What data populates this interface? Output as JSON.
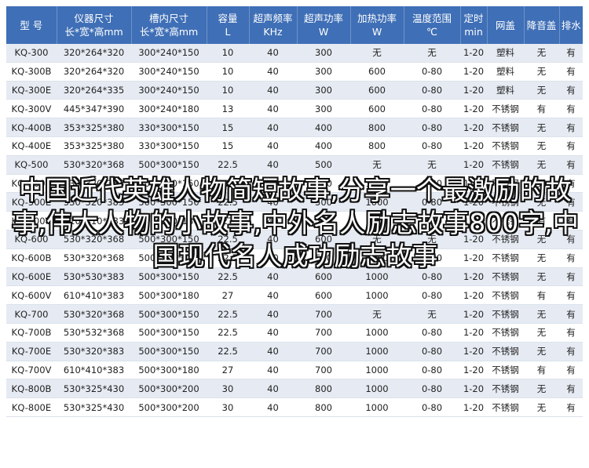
{
  "table": {
    "headers": [
      {
        "l1": "型 号",
        "l2": ""
      },
      {
        "l1": "仪器尺寸",
        "l2": "长*宽*高mm"
      },
      {
        "l1": "槽内尺寸",
        "l2": "长*宽*高mm"
      },
      {
        "l1": "容量",
        "l2": "L"
      },
      {
        "l1": "超声频率",
        "l2": "KHz"
      },
      {
        "l1": "超声功率",
        "l2": "W"
      },
      {
        "l1": "加热功率",
        "l2": "W"
      },
      {
        "l1": "温度范围",
        "l2": "℃"
      },
      {
        "l1": "定时",
        "l2": "min"
      },
      {
        "l1": "网盖",
        "l2": ""
      },
      {
        "l1": "降音盖",
        "l2": ""
      },
      {
        "l1": "排水",
        "l2": ""
      }
    ],
    "rows": [
      [
        "KQ-300",
        "320*264*320",
        "300*240*150",
        "10",
        "40",
        "300",
        "无",
        "无",
        "1-20",
        "塑料",
        "无",
        "有"
      ],
      [
        "KQ-300B",
        "320*264*320",
        "300*240*150",
        "10",
        "40",
        "300",
        "600",
        "0-80",
        "1-20",
        "塑料",
        "无",
        "有"
      ],
      [
        "KQ-300E",
        "320*264*335",
        "300*240*150",
        "10",
        "40",
        "300",
        "600",
        "0-80",
        "1-20",
        "塑料",
        "无",
        "有"
      ],
      [
        "KQ-300V",
        "445*347*390",
        "300*240*180",
        "13",
        "40",
        "300",
        "600",
        "0-80",
        "1-20",
        "不锈钢",
        "有",
        "有"
      ],
      [
        "KQ-400B",
        "353*325*380",
        "330*300*150",
        "15",
        "40",
        "400",
        "800",
        "0-80",
        "1-20",
        "不锈钢",
        "无",
        "有"
      ],
      [
        "KQ-400E",
        "353*325*380",
        "330*300*150",
        "15",
        "40",
        "400",
        "800",
        "0-80",
        "1-20",
        "不锈钢",
        "无",
        "有"
      ],
      [
        "KQ-500",
        "530*320*368",
        "500*300*150",
        "22.5",
        "40",
        "500",
        "无",
        "无",
        "1-20",
        "不锈钢",
        "无",
        "有"
      ],
      [
        "KQ-500B",
        "530*320*368",
        "500*300*150",
        "22.5",
        "40",
        "500",
        "1000",
        "0-80",
        "1-20",
        "不锈钢",
        "无",
        "有"
      ],
      [
        "KQ-500E",
        "530*320*383",
        "500*300*150",
        "22.5",
        "40",
        "500",
        "1000",
        "0-80",
        "1-20",
        "不锈钢",
        "无",
        "有"
      ],
      [
        "KQ-500V",
        "610*410*383",
        "500*300*180",
        "27",
        "40",
        "500",
        "1000",
        "0-80",
        "1-20",
        "不锈钢",
        "有",
        "有"
      ],
      [
        "KQ-600",
        "530*320*368",
        "500*300*150",
        "22.5",
        "40",
        "600",
        "无",
        "无",
        "1-20",
        "不锈钢",
        "无",
        "有"
      ],
      [
        "KQ-600B",
        "530*320*368",
        "500*300*150",
        "22.5",
        "40",
        "600",
        "1000",
        "0-80",
        "1-20",
        "不锈钢",
        "无",
        "有"
      ],
      [
        "KQ-600E",
        "530*530*383",
        "500*300*150",
        "22.5",
        "40",
        "600",
        "1000",
        "0-80",
        "1-20",
        "不锈钢",
        "无",
        "有"
      ],
      [
        "KQ-600V",
        "610*410*383",
        "500*300*180",
        "27",
        "40",
        "600",
        "1000",
        "0-80",
        "1-20",
        "不锈钢",
        "有",
        "有"
      ],
      [
        "KQ-700",
        "530*320*368",
        "500*300*150",
        "22.5",
        "40",
        "700",
        "无",
        "无",
        "1-20",
        "不锈钢",
        "无",
        "有"
      ],
      [
        "KQ-700B",
        "530*532*368",
        "500*300*150",
        "22.5",
        "40",
        "700",
        "1000",
        "0-80",
        "1-20",
        "不锈钢",
        "无",
        "有"
      ],
      [
        "KQ-700E",
        "530*320*383",
        "500*300*150",
        "22.5",
        "40",
        "700",
        "1000",
        "0-80",
        "1-20",
        "不锈钢",
        "无",
        "有"
      ],
      [
        "KQ-700V",
        "610*410*383",
        "500*300*180",
        "27",
        "40",
        "700",
        "1000",
        "0-80",
        "1-20",
        "不锈钢",
        "有",
        "有"
      ],
      [
        "KQ-800B",
        "530*325*430",
        "500*300*200",
        "30",
        "40",
        "800",
        "1000",
        "0-80",
        "1-20",
        "不锈钢",
        "无",
        "有"
      ],
      [
        "KQ-800E",
        "530*325*430",
        "500*300*200",
        "30",
        "40",
        "800",
        "1000",
        "0-80",
        "1-20",
        "不锈钢",
        "无",
        "有"
      ]
    ]
  },
  "overlay_text": "中国近代英雄人物简短故事,分享一个最激励的故事,伟大人物的小故事,中外名人励志故事800字,中国现代名人成功励志故事"
}
